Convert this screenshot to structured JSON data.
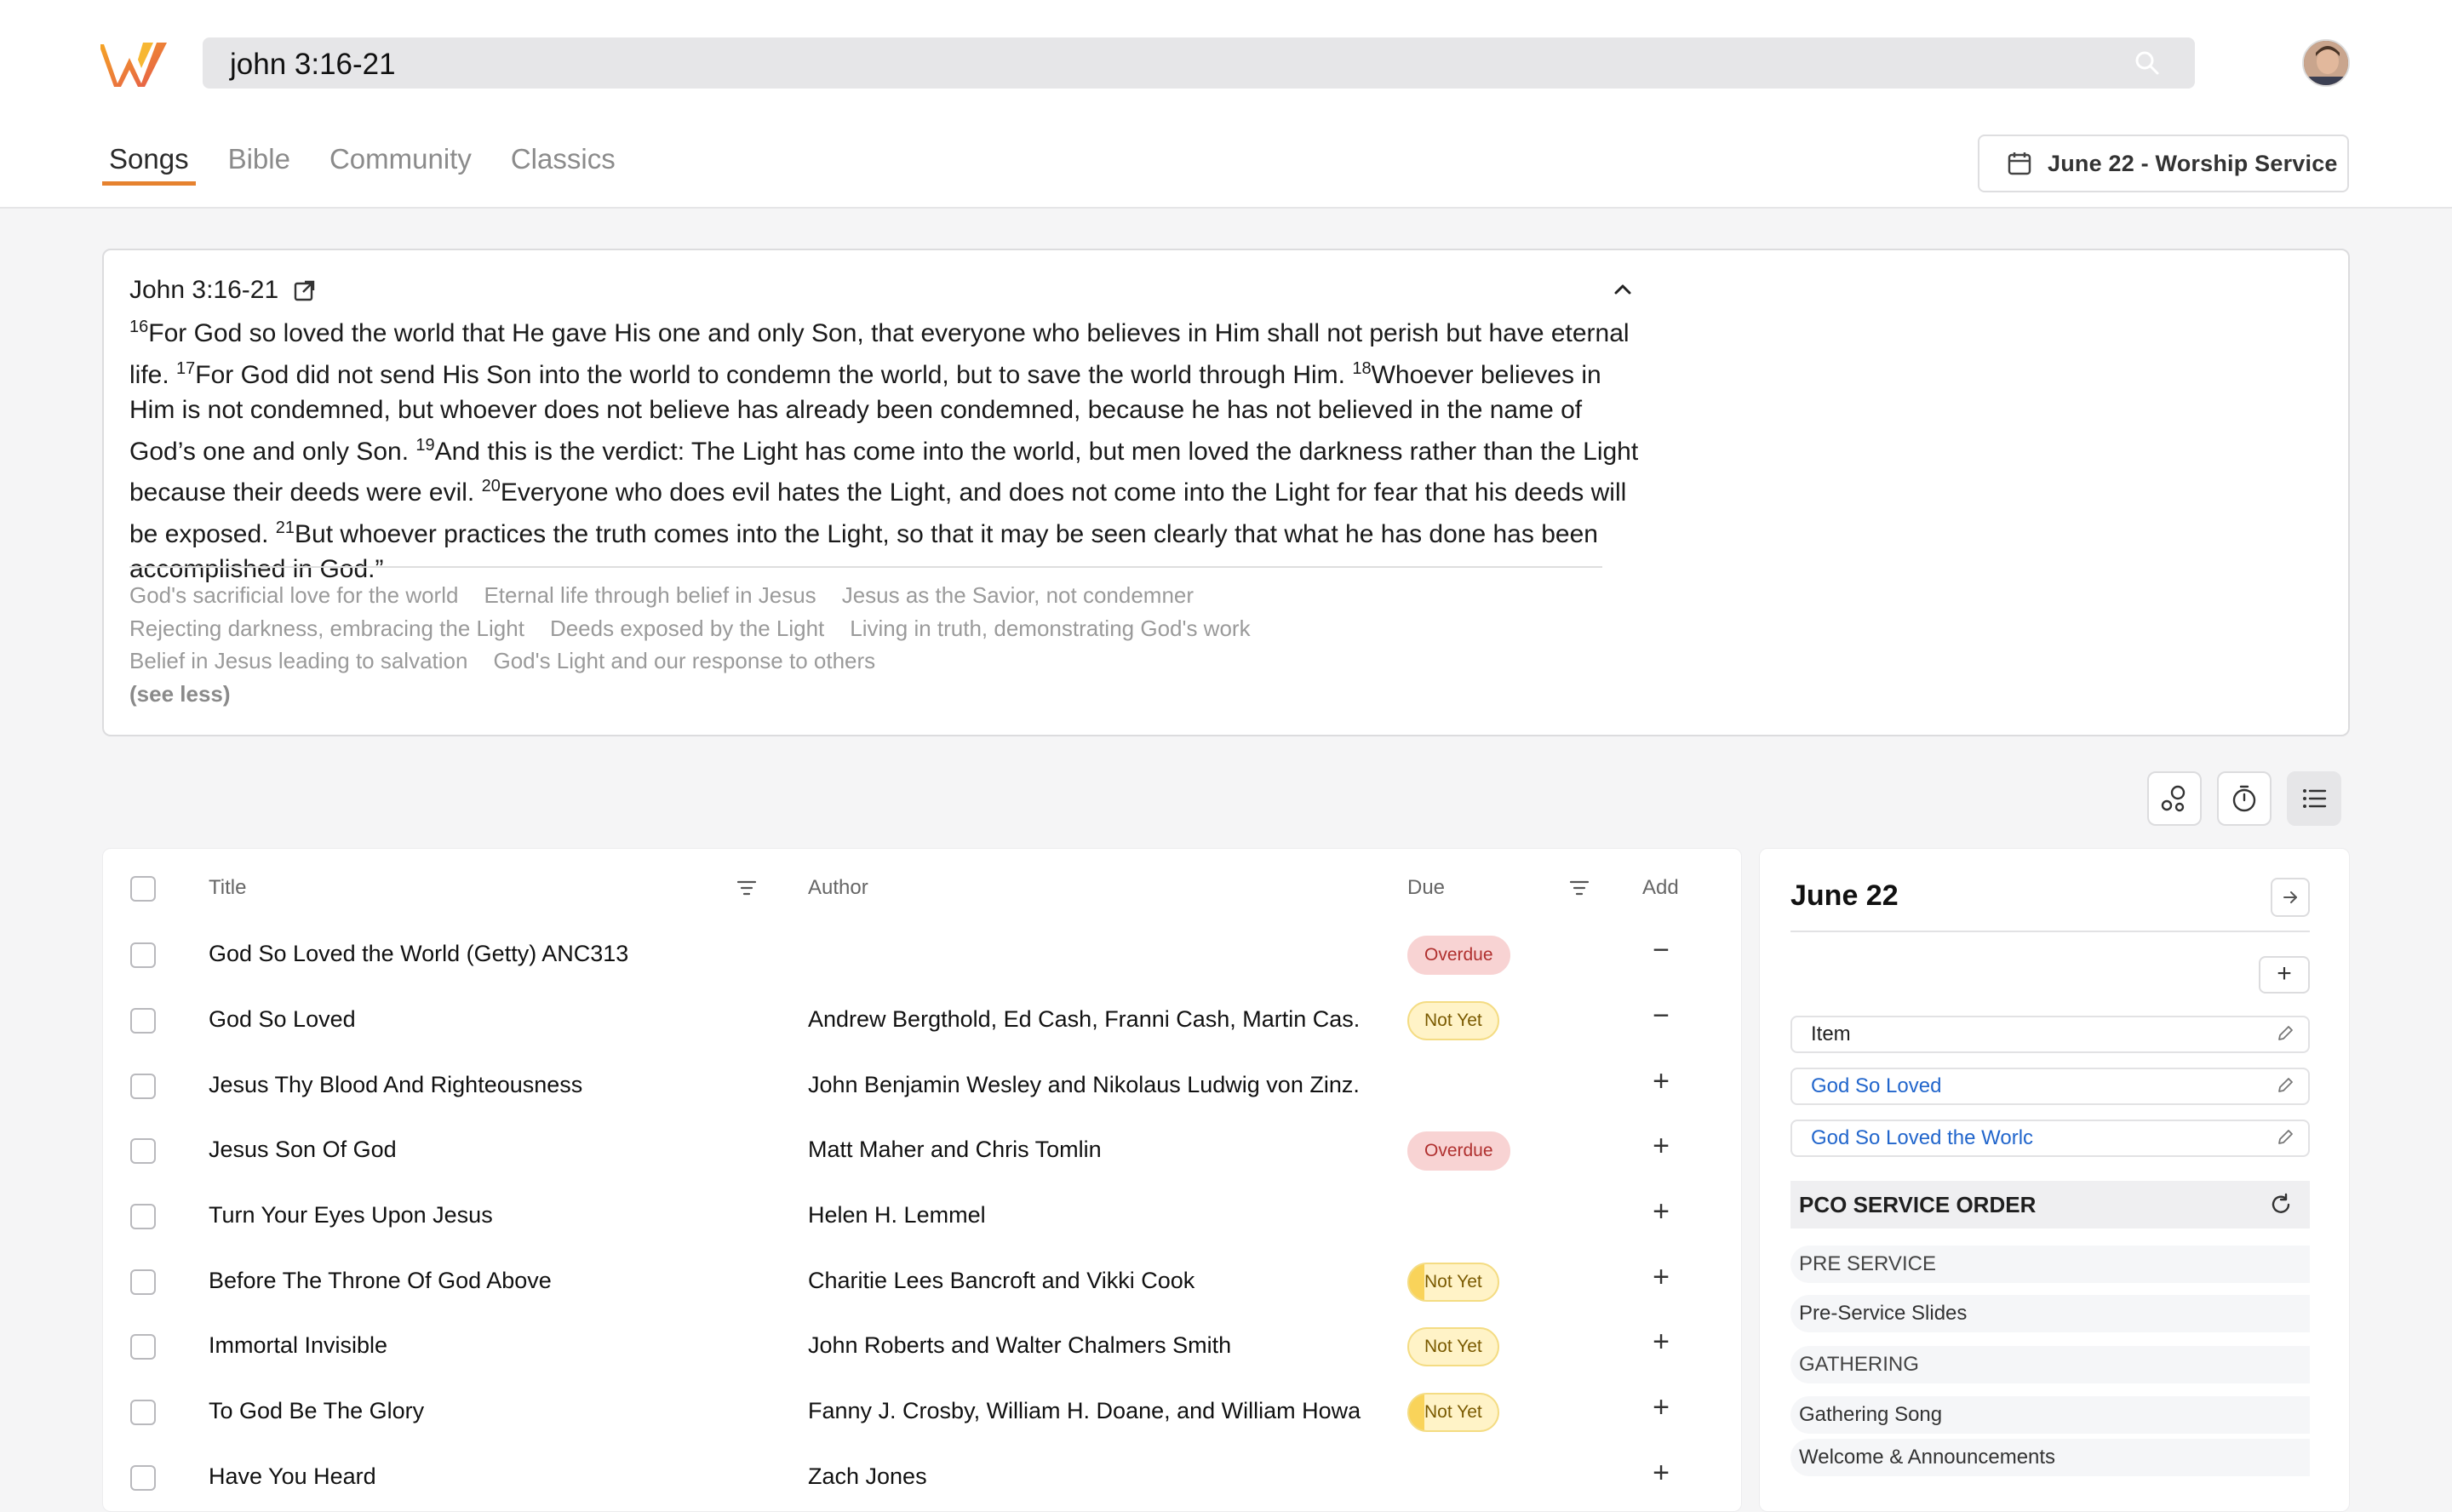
{
  "search": {
    "value": "john 3:16-21"
  },
  "tabs": [
    {
      "label": "Songs",
      "active": true
    },
    {
      "label": "Bible",
      "active": false
    },
    {
      "label": "Community",
      "active": false
    },
    {
      "label": "Classics",
      "active": false
    }
  ],
  "service_button": {
    "label": "June 22 - Worship Service"
  },
  "passage": {
    "reference": "John 3:16-21",
    "verses": [
      {
        "num": "16",
        "text": "For God so loved the world that He gave His one and only Son, that everyone who believes in Him shall not perish but have eternal life. "
      },
      {
        "num": "17",
        "text": "For God did not send His Son into the world to condemn the world, but to save the world through Him. "
      },
      {
        "num": "18",
        "text": "Whoever believes in Him is not condemned, but whoever does not believe has already been condemned, because he has not believed in the name of God’s one and only Son. "
      },
      {
        "num": "19",
        "text": "And this is the verdict: The Light has come into the world, but men loved the darkness rather than the Light because their deeds were evil. "
      },
      {
        "num": "20",
        "text": "Everyone who does evil hates the Light, and does not come into the Light for fear that his deeds will be exposed. "
      },
      {
        "num": "21",
        "text": "But whoever practices the truth comes into the Light, so that it may be seen clearly that what he has done has been accomplished in God.”"
      }
    ],
    "themes": [
      [
        "God's sacrificial love for the world",
        "Eternal life through belief in Jesus",
        "Jesus as the Savior, not condemner"
      ],
      [
        "Rejecting darkness, embracing the Light",
        "Deeds exposed by the Light",
        "Living in truth, demonstrating God's work"
      ],
      [
        "Belief in Jesus leading to salvation",
        "God's Light and our response to others"
      ]
    ],
    "see_less": "(see less)"
  },
  "table": {
    "columns": {
      "title": "Title",
      "author": "Author",
      "due": "Due",
      "add": "Add"
    },
    "rows": [
      {
        "title": "God So Loved the World (Getty) ANC313",
        "author": "",
        "due": "Overdue",
        "due_style": "overdue",
        "add": "−"
      },
      {
        "title": "God So Loved",
        "author": "Andrew Bergthold, Ed Cash, Franni Cash, Martin Cas...",
        "due": "Not Yet",
        "due_style": "notyet",
        "add": "−"
      },
      {
        "title": "Jesus Thy Blood And Righteousness",
        "author": "John Benjamin Wesley and Nikolaus Ludwig von Zinz...",
        "due": "",
        "due_style": "",
        "add": "+"
      },
      {
        "title": "Jesus Son Of God",
        "author": "Matt Maher and Chris Tomlin",
        "due": "Overdue",
        "due_style": "overdue",
        "add": "+"
      },
      {
        "title": "Turn Your Eyes Upon Jesus",
        "author": "Helen H. Lemmel",
        "due": "",
        "due_style": "",
        "add": "+"
      },
      {
        "title": "Before The Throne Of God Above",
        "author": "Charitie Lees Bancroft and Vikki Cook",
        "due": "Not Yet",
        "due_style": "notyet half",
        "add": "+"
      },
      {
        "title": "Immortal Invisible",
        "author": "John Roberts and Walter Chalmers Smith",
        "due": "Not Yet",
        "due_style": "notyet",
        "add": "+"
      },
      {
        "title": "To God Be The Glory",
        "author": "Fanny J. Crosby, William H. Doane, and William Howa...",
        "due": "Not Yet",
        "due_style": "notyet half",
        "add": "+"
      },
      {
        "title": "Have You Heard",
        "author": "Zach Jones",
        "due": "",
        "due_style": "",
        "add": "+"
      }
    ]
  },
  "panel": {
    "title": "June 22",
    "add": "+",
    "items": [
      {
        "label": "Item",
        "link": false
      },
      {
        "label": "God So Loved",
        "link": true
      },
      {
        "label": "God So Loved the Worlc",
        "link": true
      }
    ],
    "pco_title": "PCO SERVICE ORDER",
    "pco_rows": [
      {
        "label": "PRE SERVICE",
        "section": true
      },
      {
        "label": "Pre-Service Slides",
        "section": false
      },
      {
        "label": "GATHERING",
        "section": true
      },
      {
        "label": "Gathering Song",
        "section": false
      },
      {
        "label": "Welcome & Announcements",
        "section": false
      }
    ]
  },
  "colors": {
    "accent": "#e6822f",
    "link": "#2266cc",
    "overdue_bg": "#f8d3d3",
    "notyet_bg": "#fff3c7"
  }
}
